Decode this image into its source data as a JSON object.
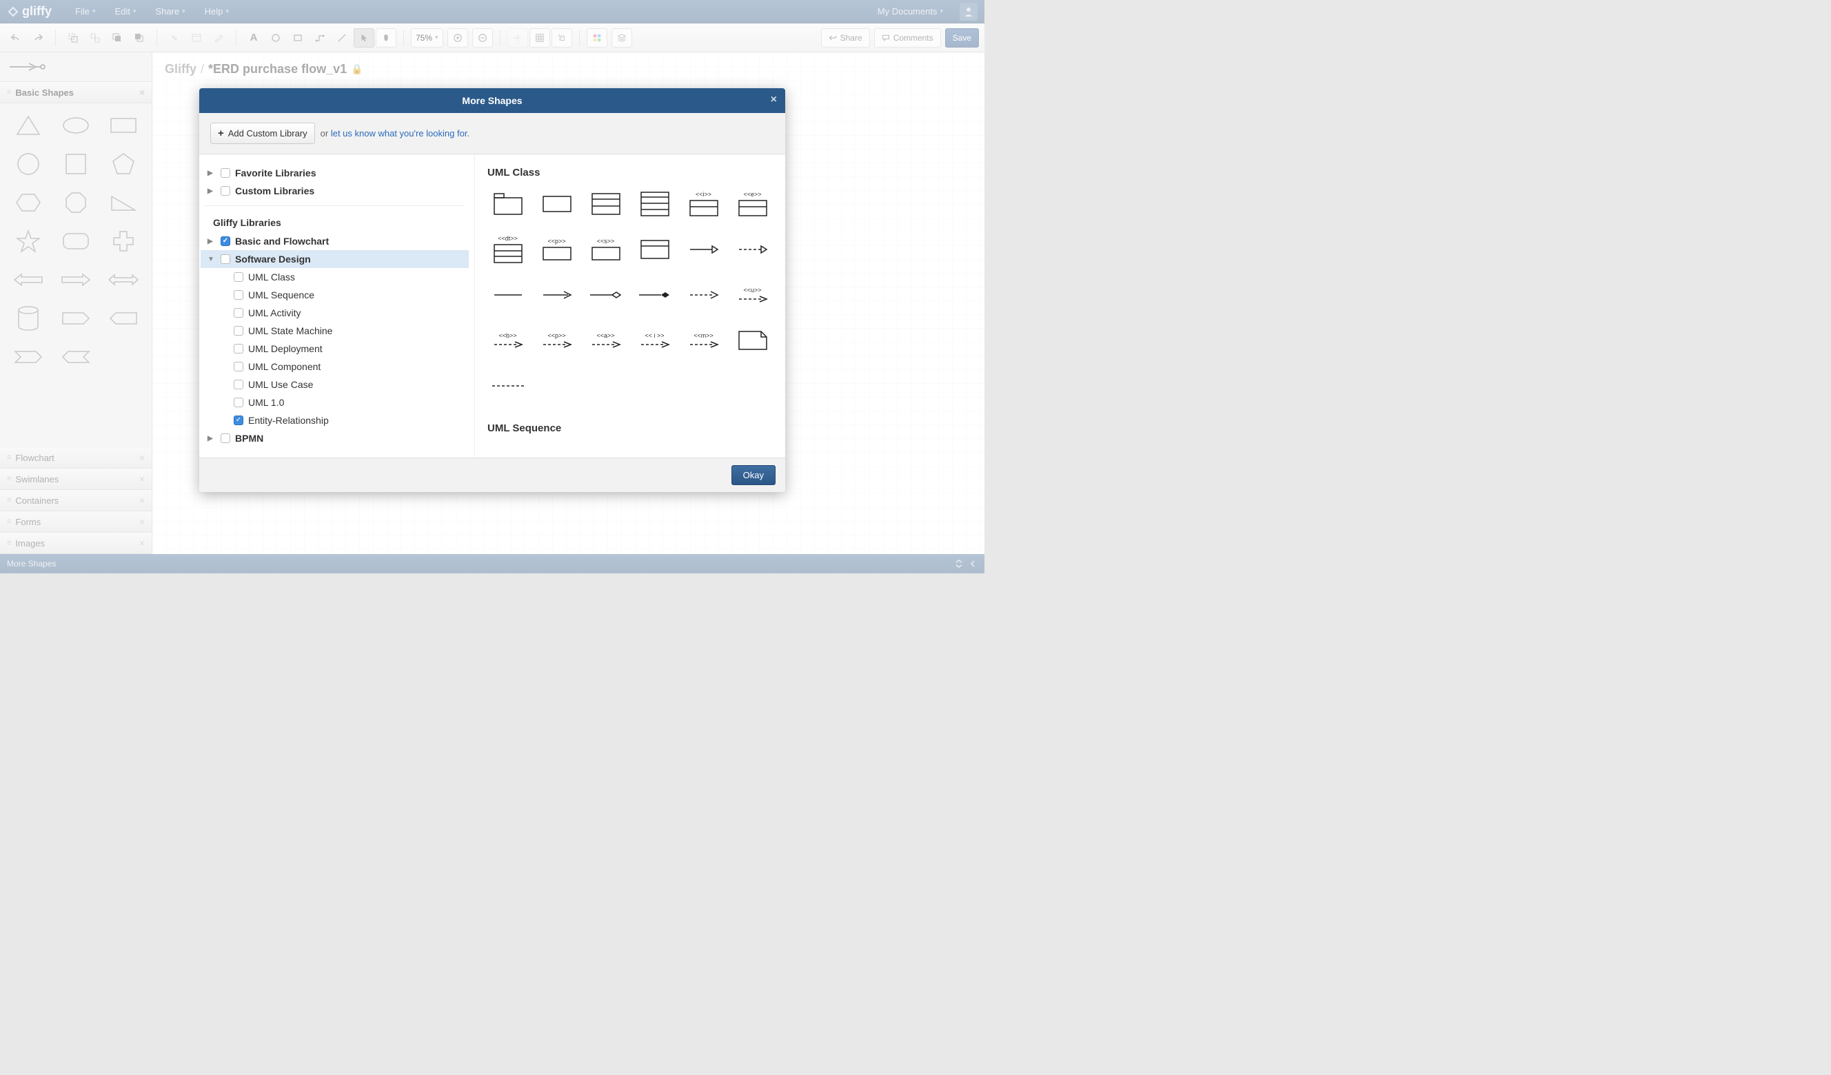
{
  "app": {
    "name": "gliffy"
  },
  "menubar": {
    "items": [
      "File",
      "Edit",
      "Share",
      "Help"
    ],
    "my_documents": "My Documents"
  },
  "toolbar": {
    "zoom": "75%",
    "share": "Share",
    "comments": "Comments",
    "save": "Save"
  },
  "breadcrumb": {
    "root": "Gliffy",
    "doc": "*ERD purchase flow_v1"
  },
  "sidebar": {
    "basic_shapes": "Basic Shapes",
    "categories": [
      "Flowchart",
      "Swimlanes",
      "Containers",
      "Forms",
      "Images"
    ],
    "more_shapes": "More Shapes"
  },
  "modal": {
    "title": "More Shapes",
    "add_custom": "Add Custom Library",
    "or": "or",
    "link_text": "let us know what you're looking for",
    "favorite": "Favorite Libraries",
    "custom": "Custom Libraries",
    "gliffy_libs": "Gliffy Libraries",
    "tree": {
      "basic_flowchart": "Basic and Flowchart",
      "software_design": "Software Design",
      "children": [
        "UML Class",
        "UML Sequence",
        "UML Activity",
        "UML State Machine",
        "UML Deployment",
        "UML Component",
        "UML Use Case",
        "UML 1.0",
        "Entity-Relationship"
      ],
      "bpmn": "BPMN"
    },
    "preview": {
      "uml_class": "UML Class",
      "uml_sequence": "UML Sequence",
      "labels": {
        "i": "<<i>>",
        "e": "<<e>>",
        "dt": "<<dt>>",
        "p": "<<p>>",
        "s": "<<s>>",
        "u": "<<u>>",
        "b": "<<b>>",
        "p2": "<<p>>",
        "a": "<<a>>",
        "i2": "<< i >>",
        "m": "<<m>>"
      }
    },
    "okay": "Okay"
  }
}
